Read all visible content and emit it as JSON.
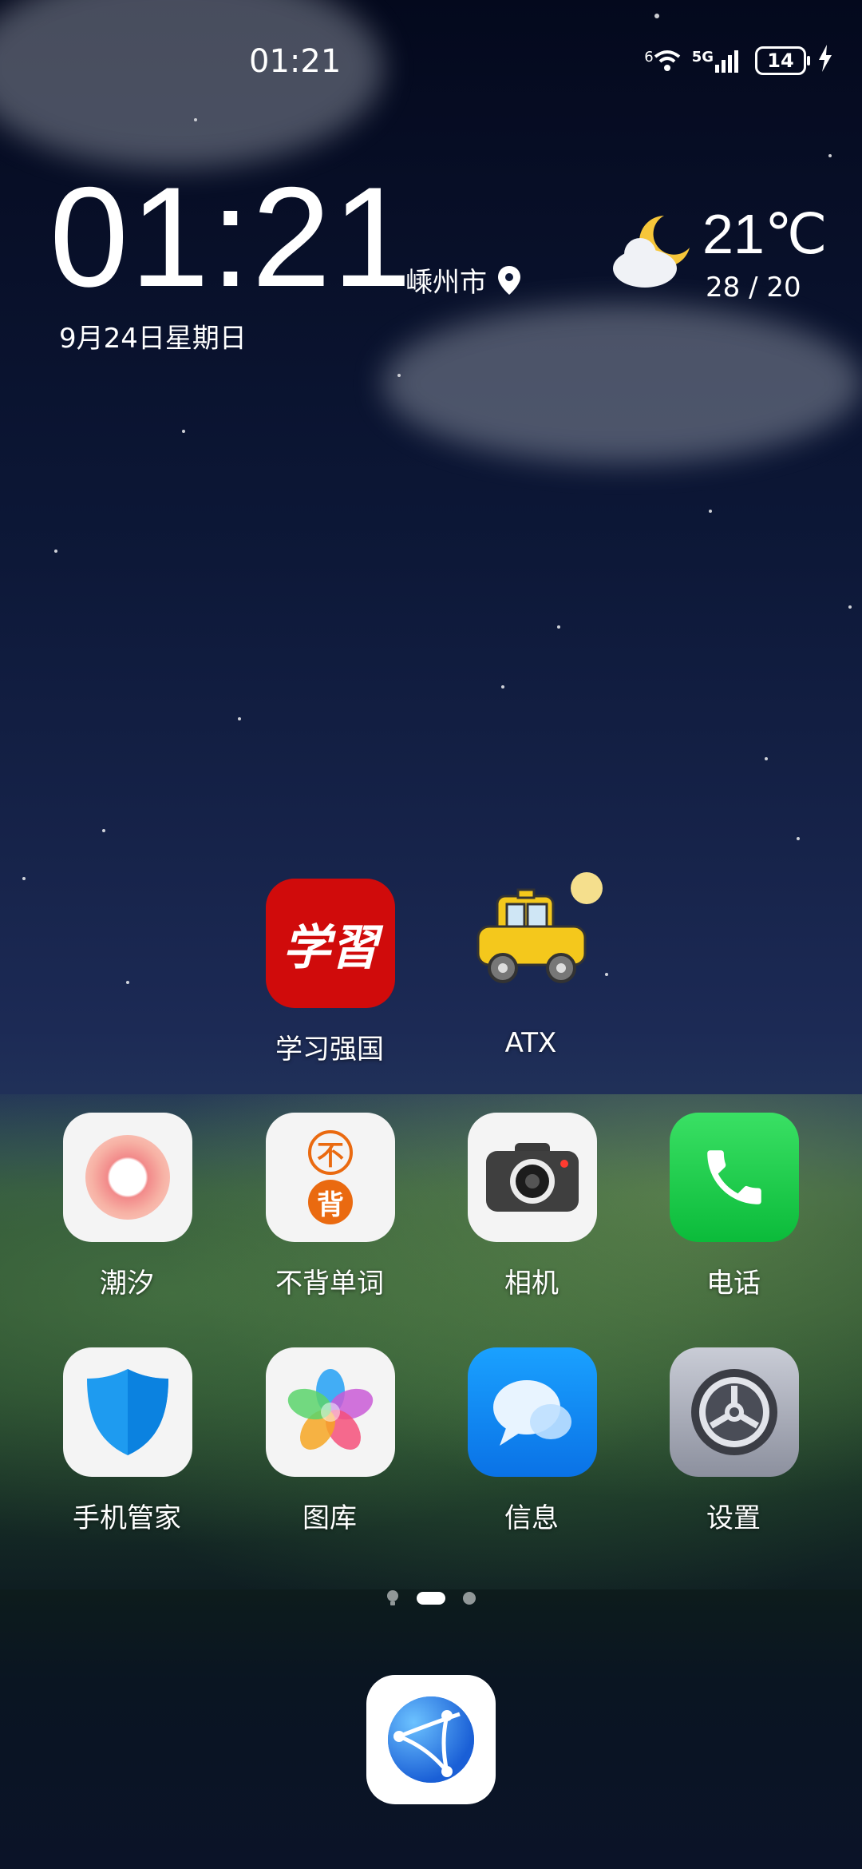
{
  "status_bar": {
    "time": "01:21",
    "wifi": "6",
    "network": "5G",
    "battery": "14"
  },
  "clock_widget": {
    "time": "01:21",
    "city": "嵊州市",
    "date": "9月24日星期日"
  },
  "weather_widget": {
    "temp": "21℃",
    "range": "28 / 20"
  },
  "apps": {
    "xuexi": "学习强国",
    "atx": "ATX",
    "chaoxi": "潮汐",
    "bubei": "不背单词",
    "bubei_top": "不",
    "bubei_bottom": "背",
    "xiangji": "相机",
    "dianhua": "电话",
    "guanjia": "手机管家",
    "tuku": "图库",
    "xinxi": "信息",
    "shezhi": "设置"
  },
  "icons": {
    "xuexi_text": "学習"
  },
  "page_indicator": {
    "count": 2,
    "active": 1
  }
}
